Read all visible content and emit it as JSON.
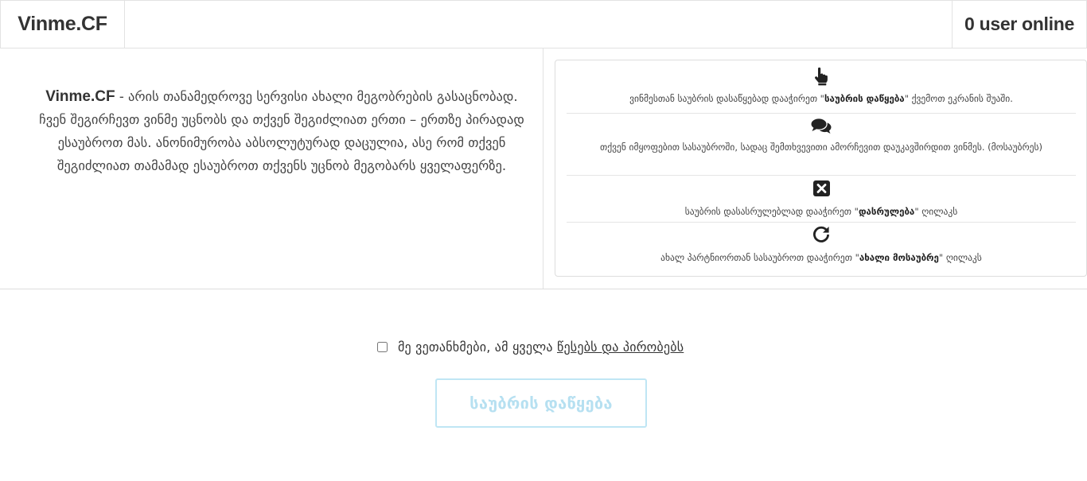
{
  "navbar": {
    "brand": "Vinme.CF",
    "online_status": "0 user online"
  },
  "about": {
    "brand": "Vinme.CF",
    "text": " - არის თანამედროვე სერვისი ახალი მეგობრების გასაცნობად. ჩვენ შეგირჩევთ ვინმე უცნობს და თქვენ შეგიძლიათ ერთი – ერთზე პირადად ესაუბროთ მას. ანონიმურობა აბსოლუტურად დაცულია, ასე რომ თქვენ შეგიძლიათ თამამად ესაუბროთ თქვენს უცნობ მეგობარს ყველაფერზე."
  },
  "help": {
    "items": [
      {
        "icon": "pointer-hand-icon",
        "before": "ვინმესთან საუბრის დასაწყებად დააჭირეთ \"",
        "bold": "საუბრის დაწყება",
        "after": "\" ქვემოთ ეკრანის შუაში."
      },
      {
        "icon": "chat-bubbles-icon",
        "before": "თქვენ იმყოფებით სასაუბროში, სადაც შემთხვევითი ამორჩევით დაუკავშირდით ვინმეს. (მოსაუბრეს)",
        "bold": "",
        "after": ""
      },
      {
        "icon": "close-square-icon",
        "before": "საუბრის დასასრულებლად დააჭირეთ \"",
        "bold": "დასრულება",
        "after": "\" ღილაკს"
      },
      {
        "icon": "refresh-icon",
        "before": "ახალ პარტნიორთან სასაუბროთ დააჭირეთ \"",
        "bold": "ახალი მოსაუბრე",
        "after": "\" ღილაკს"
      }
    ]
  },
  "agreement": {
    "checked": false,
    "label_prefix": "მე ვეთანხმები, ამ ყველა ",
    "label_link": "წესებს და პირობებს"
  },
  "start_button": {
    "label": "საუბრის დაწყება"
  },
  "colors": {
    "button_border": "#bfe6f4",
    "button_text": "#b6e0f1",
    "border": "#e2e2e2"
  }
}
